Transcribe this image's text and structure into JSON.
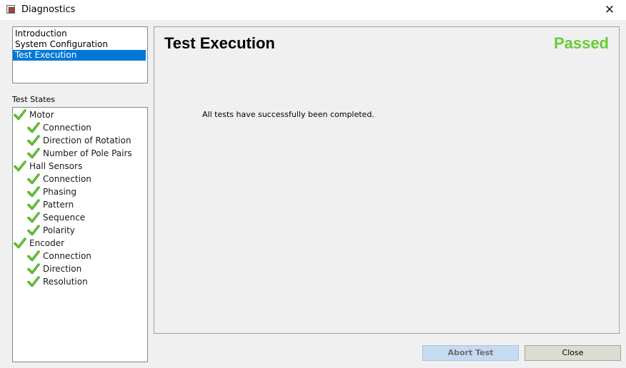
{
  "window": {
    "title": "Diagnostics",
    "close_glyph": "✕"
  },
  "nav": {
    "items": [
      {
        "label": "Introduction",
        "selected": false
      },
      {
        "label": "System Configuration",
        "selected": false
      },
      {
        "label": "Test Execution",
        "selected": true
      }
    ]
  },
  "states": {
    "heading": "Test States",
    "check_color": "#3fa31a",
    "items": [
      {
        "label": "Motor",
        "level": 0,
        "status": "passed"
      },
      {
        "label": "Connection",
        "level": 1,
        "status": "passed"
      },
      {
        "label": "Direction of Rotation",
        "level": 1,
        "status": "passed"
      },
      {
        "label": "Number of Pole Pairs",
        "level": 1,
        "status": "passed"
      },
      {
        "label": "Hall Sensors",
        "level": 0,
        "status": "passed"
      },
      {
        "label": "Connection",
        "level": 1,
        "status": "passed"
      },
      {
        "label": "Phasing",
        "level": 1,
        "status": "passed"
      },
      {
        "label": "Pattern",
        "level": 1,
        "status": "passed"
      },
      {
        "label": "Sequence",
        "level": 1,
        "status": "passed"
      },
      {
        "label": "Polarity",
        "level": 1,
        "status": "passed"
      },
      {
        "label": "Encoder",
        "level": 0,
        "status": "passed"
      },
      {
        "label": "Connection",
        "level": 1,
        "status": "passed"
      },
      {
        "label": "Direction",
        "level": 1,
        "status": "passed"
      },
      {
        "label": "Resolution",
        "level": 1,
        "status": "passed"
      }
    ]
  },
  "main": {
    "title": "Test Execution",
    "status": "Passed",
    "status_color": "#66cc33",
    "message": "All tests have successfully been completed."
  },
  "buttons": {
    "abort": "Abort Test",
    "close": "Close"
  },
  "colors": {
    "selection": "#0078d7",
    "abort_button_bg": "#c6dbf1",
    "close_button_bg": "#dcdcd0"
  }
}
